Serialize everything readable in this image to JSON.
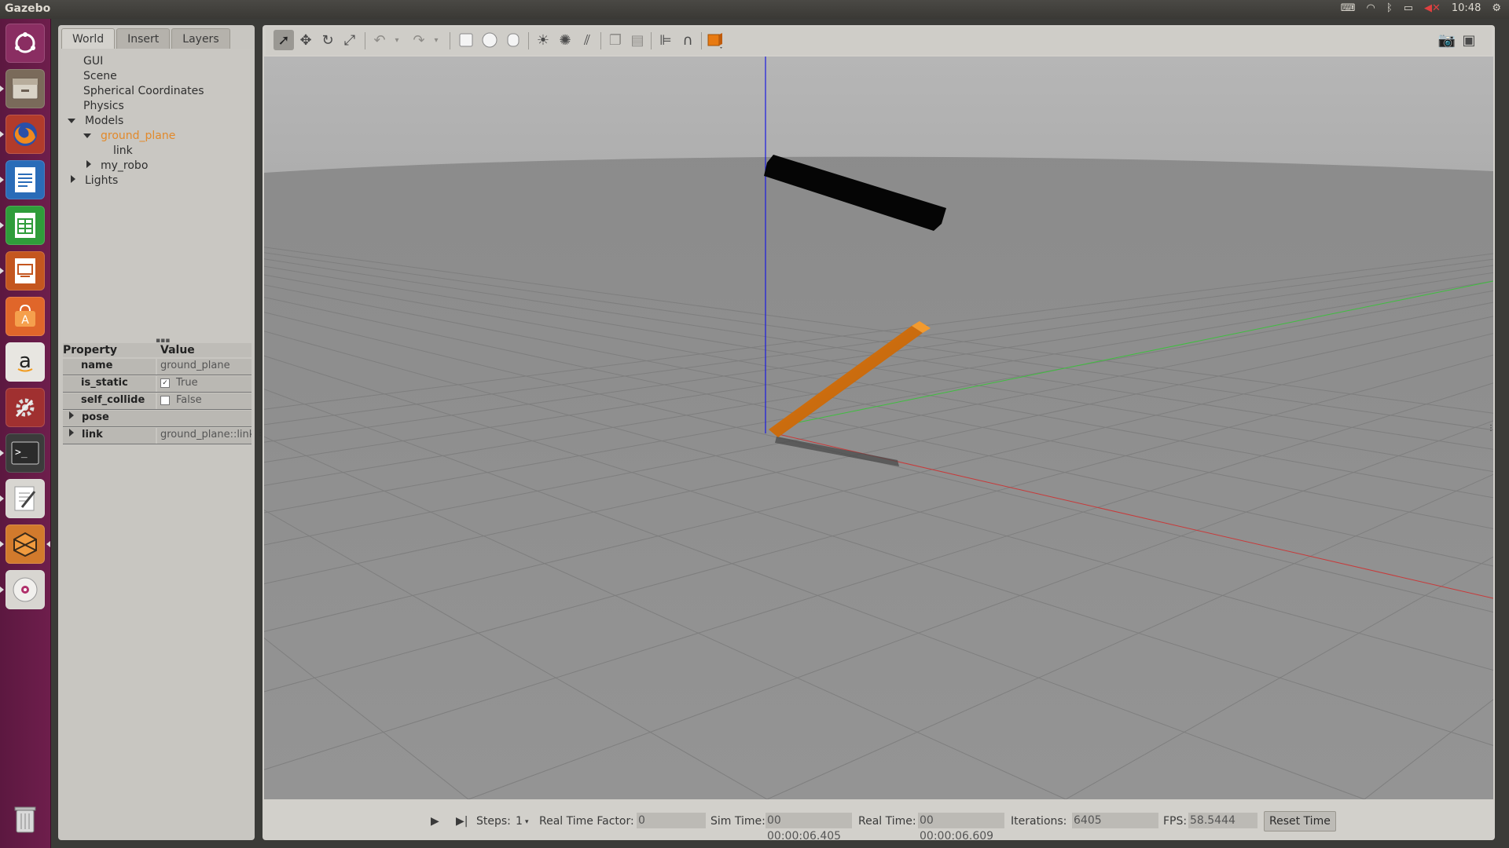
{
  "topbar": {
    "title": "Gazebo",
    "time": "10:48",
    "icons": [
      "keyboard-icon",
      "wifi-icon",
      "bluetooth-icon",
      "battery-icon",
      "volume-muted-icon",
      "settings-gear-icon"
    ]
  },
  "launcher": {
    "items": [
      "ubuntu-dash",
      "files",
      "firefox",
      "libreoffice-writer",
      "libreoffice-calc",
      "libreoffice-impress",
      "ubuntu-software",
      "amazon",
      "system-settings",
      "terminal",
      "text-editor",
      "gazebo",
      "dvd",
      "trash"
    ]
  },
  "left_panel": {
    "tabs": [
      "World",
      "Insert",
      "Layers"
    ],
    "active_tab": "World",
    "tree": {
      "gui": "GUI",
      "scene": "Scene",
      "spherical": "Spherical Coordinates",
      "physics": "Physics",
      "models": "Models",
      "ground_plane": "ground_plane",
      "link": "link",
      "my_robo": "my_robo",
      "lights": "Lights"
    },
    "properties": {
      "header_property": "Property",
      "header_value": "Value",
      "rows": {
        "name_label": "name",
        "name_value": "ground_plane",
        "is_static_label": "is_static",
        "is_static_value": "True",
        "self_collide_label": "self_collide",
        "self_collide_value": "False",
        "pose_label": "pose",
        "link_label": "link",
        "link_value": "ground_plane::link"
      }
    }
  },
  "toolbar": {
    "tools": [
      "select-mode",
      "translate-mode",
      "rotate-mode",
      "scale-mode",
      "undo",
      "redo",
      "box-shape",
      "sphere-shape",
      "cylinder-shape",
      "point-light",
      "spot-light",
      "directional-light",
      "copy",
      "paste",
      "align",
      "snap",
      "change-view",
      "screenshot",
      "log-data"
    ]
  },
  "bottom_bar": {
    "steps_label": "Steps:",
    "steps_value": "1",
    "rtf_label": "Real Time Factor:",
    "rtf_value": "0",
    "sim_time_label": "Sim Time:",
    "sim_time_value": "00 00:00:06.405",
    "real_time_label": "Real Time:",
    "real_time_value": "00 00:00:06.609",
    "iterations_label": "Iterations:",
    "iterations_value": "6405",
    "fps_label": "FPS:",
    "fps_value": "58.5444",
    "reset_label": "Reset Time"
  },
  "colors": {
    "launcher": "#6e1e4c",
    "selected_tree_item": "#e2892a",
    "orange_link": "#d9730e",
    "sky": "#b3b3b3",
    "ground": "#8f8f8f"
  }
}
